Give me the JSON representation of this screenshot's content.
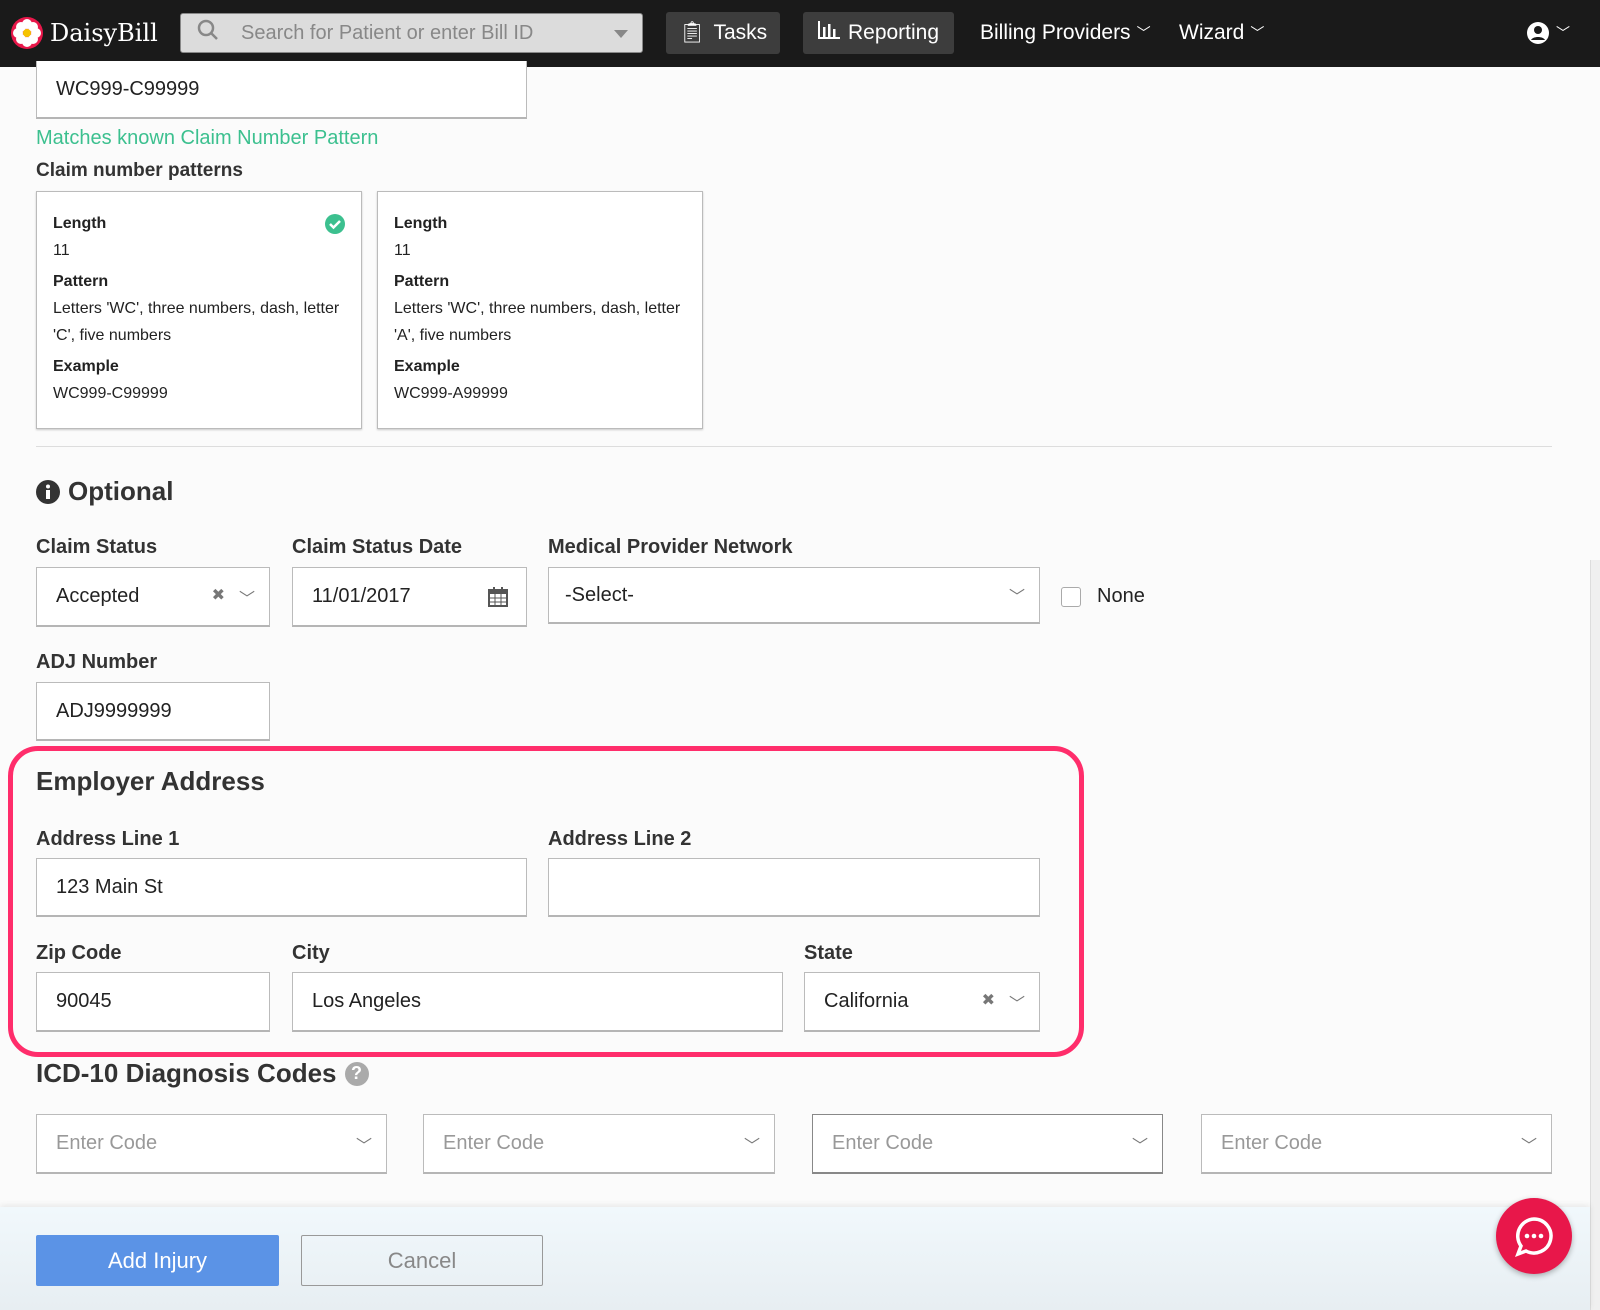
{
  "nav": {
    "brand": "DaisyBill",
    "search_placeholder": "Search for Patient or enter Bill ID",
    "tasks": "Tasks",
    "reporting": "Reporting",
    "billing_providers": "Billing Providers",
    "wizard": "Wizard"
  },
  "claim": {
    "number": "WC999-C99999",
    "match_message": "Matches known Claim Number Pattern",
    "patterns_title": "Claim number patterns",
    "patterns": [
      {
        "length_label": "Length",
        "length": "11",
        "pattern_label": "Pattern",
        "pattern": "Letters 'WC', three numbers, dash, letter 'C', five numbers",
        "example_label": "Example",
        "example": "WC999-C99999",
        "matched": true
      },
      {
        "length_label": "Length",
        "length": "11",
        "pattern_label": "Pattern",
        "pattern": "Letters 'WC', three numbers, dash, letter 'A', five numbers",
        "example_label": "Example",
        "example": "WC999-A99999",
        "matched": false
      }
    ]
  },
  "optional": {
    "title": "Optional",
    "claim_status_label": "Claim Status",
    "claim_status": "Accepted",
    "claim_status_date_label": "Claim Status Date",
    "claim_status_date": "11/01/2017",
    "mpn_label": "Medical Provider Network",
    "mpn_value": "-Select-",
    "none_label": "None",
    "none_checked": false,
    "adj_label": "ADJ Number",
    "adj_value": "ADJ9999999"
  },
  "employer": {
    "title": "Employer Address",
    "line1_label": "Address Line 1",
    "line1": "123 Main St",
    "line2_label": "Address Line 2",
    "line2": "",
    "zip_label": "Zip Code",
    "zip": "90045",
    "city_label": "City",
    "city": "Los Angeles",
    "state_label": "State",
    "state": "California"
  },
  "icd": {
    "title": "ICD-10 Diagnosis Codes",
    "placeholder": "Enter Code"
  },
  "footer": {
    "add": "Add Injury",
    "cancel": "Cancel"
  },
  "colors": {
    "accent_green": "#3cc08f",
    "highlight": "#ff2d6b",
    "primary": "#5b93e6",
    "chat": "#e8174a"
  }
}
